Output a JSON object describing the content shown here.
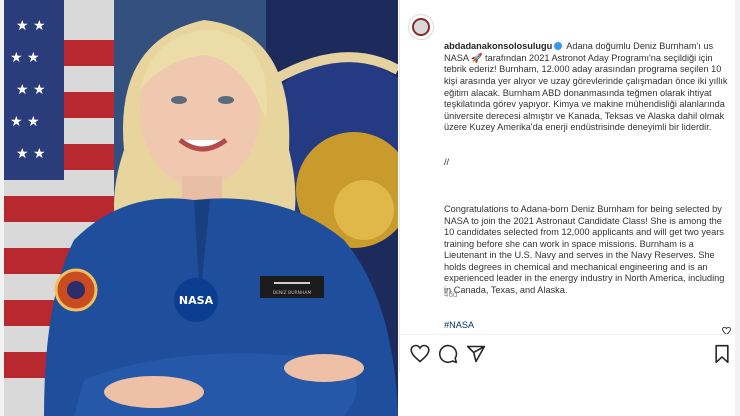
{
  "post": {
    "username": "abdadanakonsolosulugu",
    "caption_tr": "Adana doğumlu Deniz Burnham'ı us NASA 🚀 tarafından 2021 Astronot Aday Programı'na seçildiği için tebrik ederiz! Burnham, 12.000 aday arasından programa seçilen 10 kişi arasında yer alıyor ve uzay görevlerinde çalışmadan önce iki yıllık eğitim alacak. Burnham ABD donanmasında teğmen olarak ihtiyat teşkilatında görev yapıyor. Kimya ve makine mühendisliği alanlarında üniversite derecesi almıştır ve Kanada, Teksas ve Alaska dahil olmak üzere Kuzey Amerika'da enerji endüstrisinde deneyimli bir liderdir.",
    "separator": "//",
    "caption_en": "Congratulations to Adana-born Deniz Burnham for being selected by NASA to join the 2021 Astronaut Candidate Class! She is among the 10 candidates selected from 12,000 applicants and will get two years training before she can work in space missions. Burnham is a Lieutenant in the U.S. Navy and serves in the Navy Reserves. She holds degrees in chemical and mechanical engineering and is an experienced leader in the energy industry in North America, including in Canada, Texas, and Alaska.",
    "hashtag": "#NASA",
    "time": "46d"
  },
  "photo": {
    "nametag": "DENIZ BURNHAM",
    "patch_text": "NASA"
  },
  "icons": {
    "like": "heart-icon",
    "comment": "comment-icon",
    "share": "share-icon",
    "save": "bookmark-icon",
    "caption_like": "heart-small-icon"
  },
  "colors": {
    "suit": "#1f4f9c",
    "link": "#00376b",
    "verified": "#3897f0"
  }
}
